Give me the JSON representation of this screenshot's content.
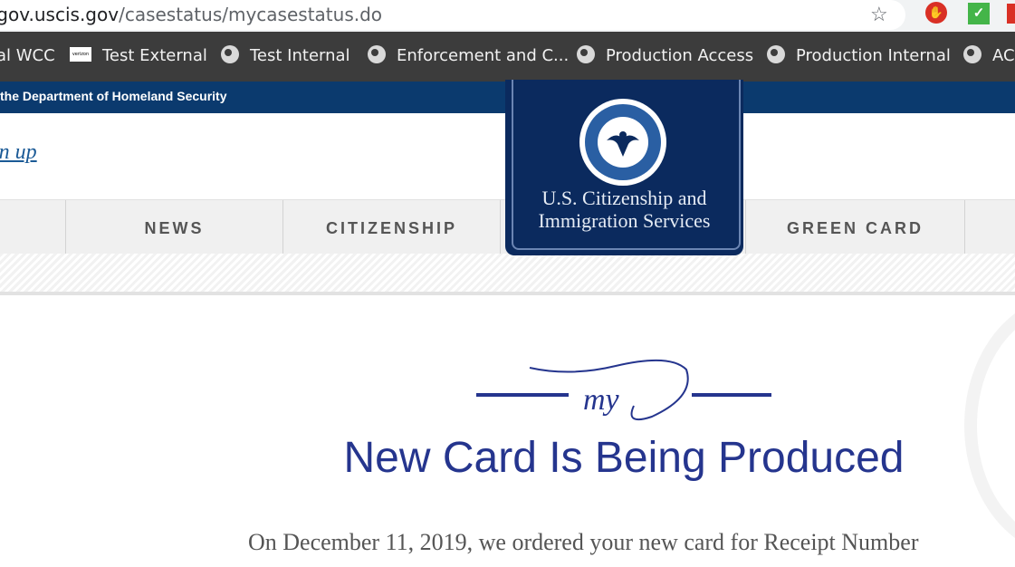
{
  "browser": {
    "url_domain": "egov.uscis.gov",
    "url_path": "/casestatus/mycasestatus.do"
  },
  "bookmarks": [
    {
      "label": "al WCC",
      "icon": "none"
    },
    {
      "label": "Test External",
      "icon": "verizon-icon"
    },
    {
      "label": "Test Internal",
      "icon": "globe-icon"
    },
    {
      "label": "Enforcement and C...",
      "icon": "globe-icon"
    },
    {
      "label": "Production Access",
      "icon": "globe-icon"
    },
    {
      "label": "Production Internal",
      "icon": "globe-icon"
    },
    {
      "label": "AC",
      "icon": "globe-icon"
    }
  ],
  "gov_banner": "the Department of Homeland Security",
  "header": {
    "signup_link": "ign up"
  },
  "nav": [
    {
      "label": "NEWS"
    },
    {
      "label": "CITIZENSHIP"
    },
    {
      "label": "GREEN CARD"
    }
  ],
  "logo": {
    "line1": "U.S. Citizenship and",
    "line2": "Immigration Services"
  },
  "status": {
    "my_label": "my",
    "title": "New Card Is Being Produced",
    "body": "On December 11, 2019, we ordered your new card for Receipt Number"
  },
  "colors": {
    "dhs_blue": "#0b3a6e",
    "title_blue": "#25358e"
  }
}
